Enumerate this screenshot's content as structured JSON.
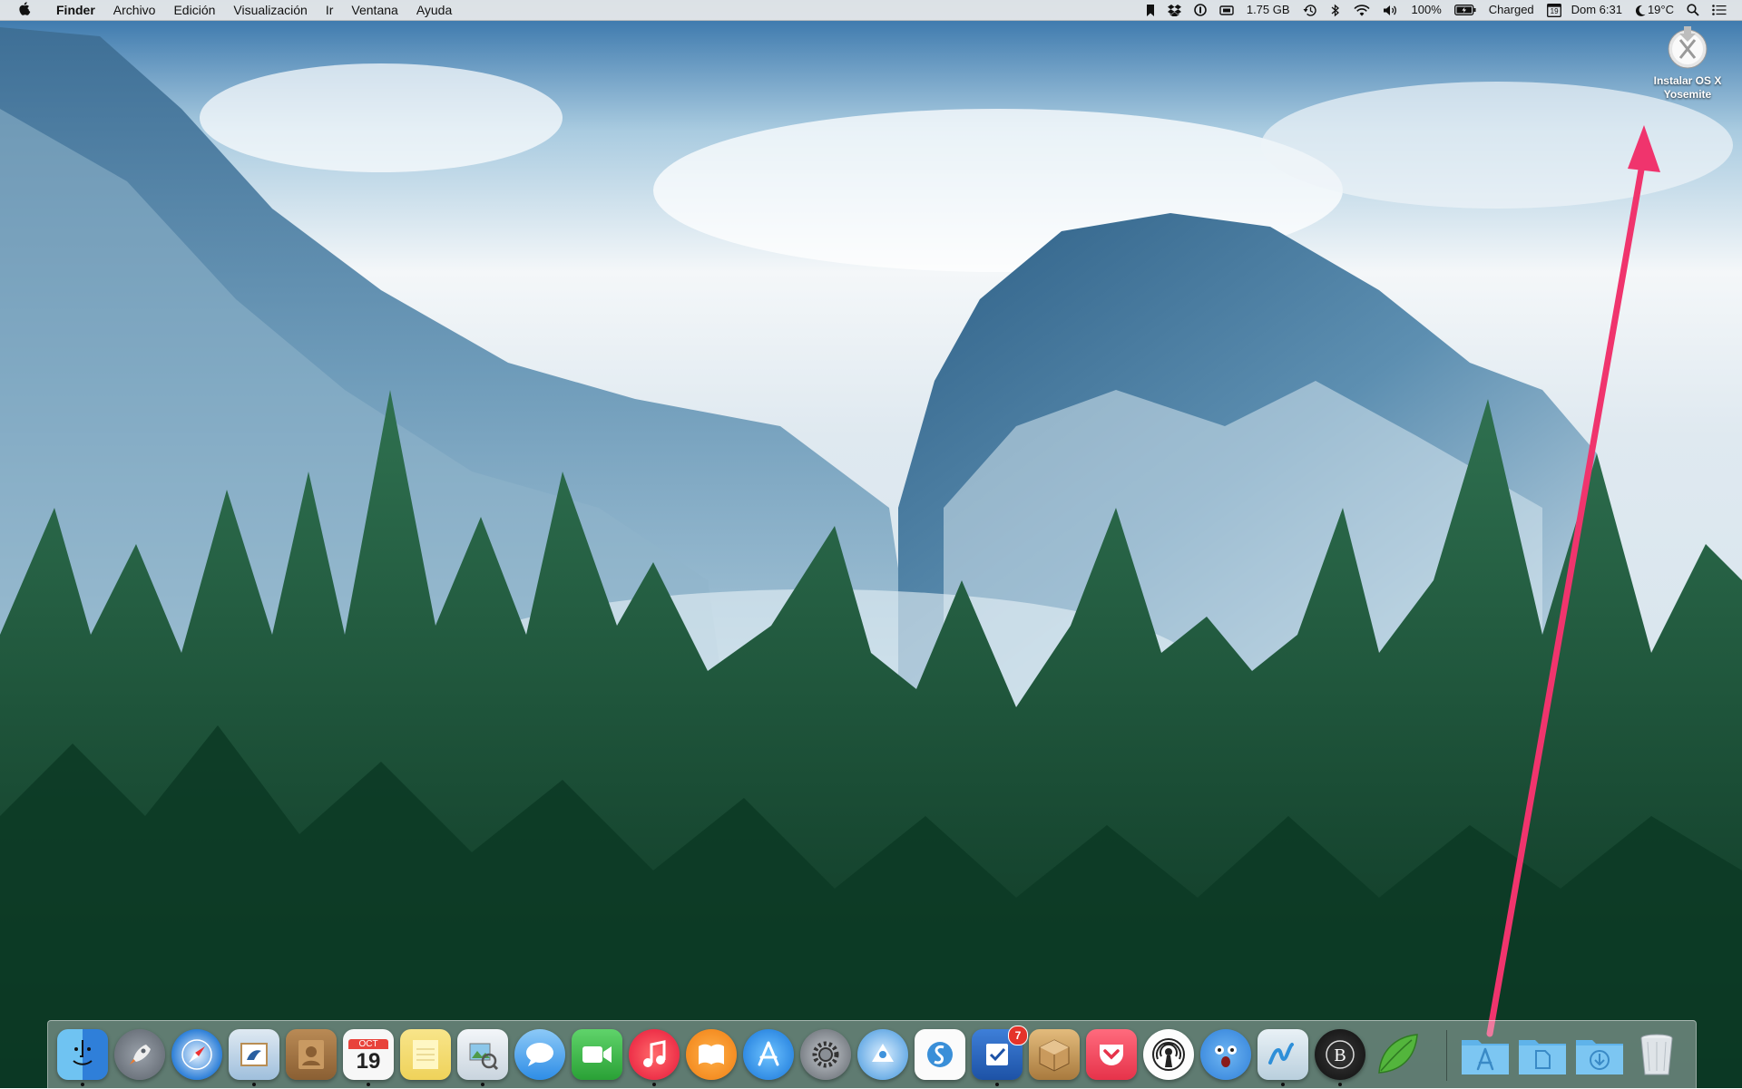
{
  "menubar": {
    "app_name": "Finder",
    "menus": [
      "Archivo",
      "Edición",
      "Visualización",
      "Ir",
      "Ventana",
      "Ayuda"
    ],
    "status": {
      "memory": "1.75 GB",
      "battery_percent": "100%",
      "battery_status": "Charged",
      "calendar_day": "19",
      "clock": "Dom 6:31",
      "weather": "19°C"
    }
  },
  "desktop": {
    "installer_label": "Instalar OS X Yosemite"
  },
  "dock": {
    "calendar_month": "OCT",
    "calendar_day": "19",
    "reminders_badge": "7",
    "apps": [
      {
        "icon": "finder-icon",
        "color": "#3a8de0"
      },
      {
        "icon": "launchpad-icon",
        "color": "#7a7f87"
      },
      {
        "icon": "safari-icon",
        "color": "#2d7fd8"
      },
      {
        "icon": "mail-icon",
        "color": "#b8d0e6"
      },
      {
        "icon": "contacts-icon",
        "color": "#a7784a"
      },
      {
        "icon": "calendar-icon",
        "color": "#f5f5f5"
      },
      {
        "icon": "notes-icon",
        "color": "#f6e27a"
      },
      {
        "icon": "preview-icon",
        "color": "#e9edf2"
      },
      {
        "icon": "messages-icon",
        "color": "#4aa6ef"
      },
      {
        "icon": "facetime-icon",
        "color": "#3dbb45"
      },
      {
        "icon": "itunes-icon",
        "color": "#f03a4f"
      },
      {
        "icon": "ibooks-icon",
        "color": "#f28a1b"
      },
      {
        "icon": "app-store-icon",
        "color": "#1f8fea"
      },
      {
        "icon": "system-preferences-icon",
        "color": "#8a8f96"
      },
      {
        "icon": "twitterrific-icon",
        "color": "#5ba7e6"
      },
      {
        "icon": "simplenote-icon",
        "color": "#ffffff"
      },
      {
        "icon": "reminders-icon",
        "color": "#2767c6"
      },
      {
        "icon": "installer-package-icon",
        "color": "#c79a5d"
      },
      {
        "icon": "pocket-icon",
        "color": "#ee4056"
      },
      {
        "icon": "podcast-icon",
        "color": "#ffffff"
      },
      {
        "icon": "tweetbot-icon",
        "color": "#3f8be0"
      },
      {
        "icon": "mindnode-icon",
        "color": "#d9e6ef"
      },
      {
        "icon": "b-app-icon",
        "color": "#1b1b1b"
      },
      {
        "icon": "leaf-icon",
        "color": "#4fb33a"
      }
    ],
    "folders": [
      {
        "icon": "applications-folder-icon"
      },
      {
        "icon": "documents-folder-icon"
      },
      {
        "icon": "downloads-folder-icon"
      }
    ],
    "trash": {
      "icon": "trash-icon"
    }
  },
  "colors": {
    "annotation_arrow": "#f0346d",
    "folder_blue": "#5fb3ea"
  }
}
